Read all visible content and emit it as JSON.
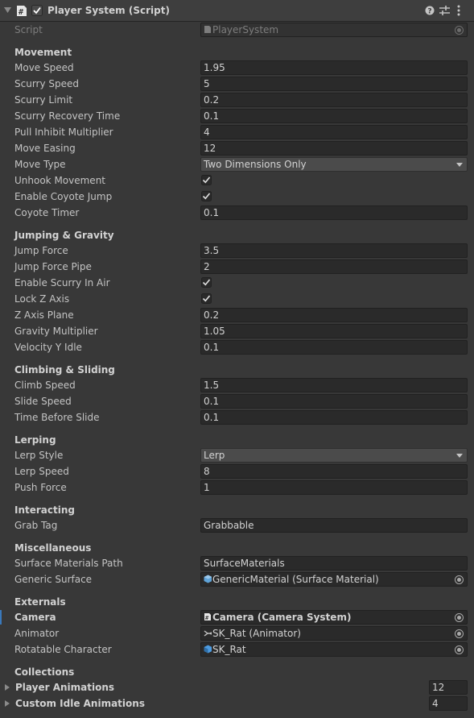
{
  "header": {
    "title": "Player System (Script)",
    "enabled": true
  },
  "script": {
    "label": "Script",
    "value": "PlayerSystem"
  },
  "sections": {
    "movement": "Movement",
    "jumping": "Jumping & Gravity",
    "climbing": "Climbing & Sliding",
    "lerping": "Lerping",
    "interacting": "Interacting",
    "misc": "Miscellaneous",
    "externals": "Externals",
    "collections": "Collections"
  },
  "fields": {
    "move_speed": {
      "label": "Move Speed",
      "value": "1.95"
    },
    "scurry_speed": {
      "label": "Scurry Speed",
      "value": "5"
    },
    "scurry_limit": {
      "label": "Scurry Limit",
      "value": "0.2"
    },
    "scurry_recovery_time": {
      "label": "Scurry Recovery Time",
      "value": "0.1"
    },
    "pull_inhibit_multiplier": {
      "label": "Pull Inhibit Multiplier",
      "value": "4"
    },
    "move_easing": {
      "label": "Move Easing",
      "value": "12"
    },
    "move_type": {
      "label": "Move Type",
      "value": "Two Dimensions Only"
    },
    "unhook_movement": {
      "label": "Unhook Movement",
      "checked": true
    },
    "enable_coyote_jump": {
      "label": "Enable Coyote Jump",
      "checked": true
    },
    "coyote_timer": {
      "label": "Coyote Timer",
      "value": "0.1"
    },
    "jump_force": {
      "label": "Jump Force",
      "value": "3.5"
    },
    "jump_force_pipe": {
      "label": "Jump Force Pipe",
      "value": "2"
    },
    "enable_scurry_in_air": {
      "label": "Enable Scurry In Air",
      "checked": true
    },
    "lock_z_axis": {
      "label": "Lock Z Axis",
      "checked": true
    },
    "z_axis_plane": {
      "label": "Z Axis Plane",
      "value": "0.2"
    },
    "gravity_multiplier": {
      "label": "Gravity Multiplier",
      "value": "1.05"
    },
    "velocity_y_idle": {
      "label": "Velocity Y Idle",
      "value": "0.1"
    },
    "climb_speed": {
      "label": "Climb Speed",
      "value": "1.5"
    },
    "slide_speed": {
      "label": "Slide Speed",
      "value": "0.1"
    },
    "time_before_slide": {
      "label": "Time Before Slide",
      "value": "0.1"
    },
    "lerp_style": {
      "label": "Lerp Style",
      "value": "Lerp"
    },
    "lerp_speed": {
      "label": "Lerp Speed",
      "value": "8"
    },
    "push_force": {
      "label": "Push Force",
      "value": "1"
    },
    "grab_tag": {
      "label": "Grab Tag",
      "value": "Grabbable"
    },
    "surface_materials_path": {
      "label": "Surface Materials Path",
      "value": "SurfaceMaterials"
    },
    "generic_surface": {
      "label": "Generic Surface",
      "value": "GenericMaterial (Surface Material)"
    },
    "camera": {
      "label": "Camera",
      "value": "Camera (Camera System)"
    },
    "animator": {
      "label": "Animator",
      "value": "SK_Rat (Animator)"
    },
    "rotatable_character": {
      "label": "Rotatable Character",
      "value": "SK_Rat"
    },
    "player_animations": {
      "label": "Player Animations",
      "value": "12"
    },
    "custom_idle_animations": {
      "label": "Custom Idle Animations",
      "value": "4"
    }
  },
  "colors": {
    "accent": "#3a79bb",
    "background": "#383838",
    "field": "#2a2a2a"
  },
  "icons": [
    "foldout-arrow-icon",
    "script-icon",
    "checkbox-icon",
    "help-icon",
    "presets-icon",
    "menu-icon",
    "object-picker-icon",
    "material-icon",
    "animator-icon",
    "prefab-icon"
  ]
}
